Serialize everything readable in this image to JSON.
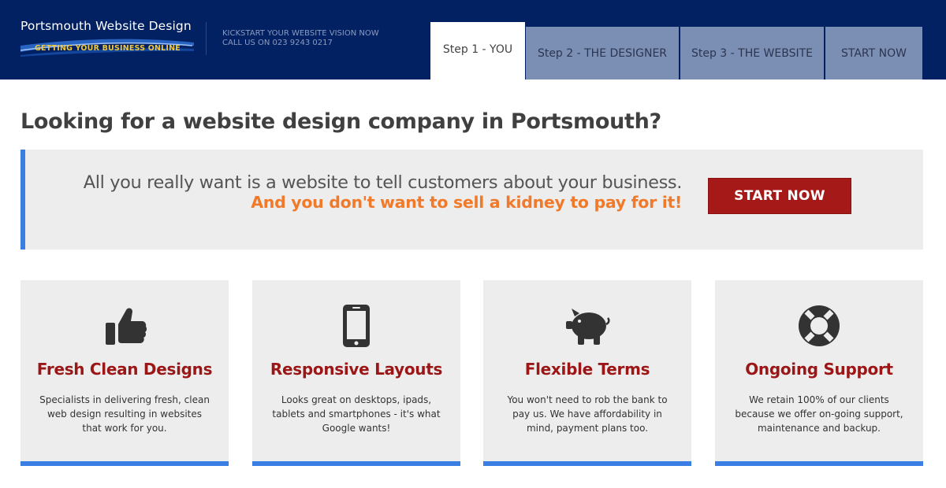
{
  "header": {
    "logo_title": "Portsmouth Website Design",
    "logo_tagline": "GETTING YOUR BUSINESS ONLINE",
    "tagline_line1": "KICKSTART YOUR WEBSITE VISION NOW",
    "tagline_line2": "CALL US ON 023 9243 0217"
  },
  "nav": {
    "tabs": [
      {
        "label": "Step 1 - YOU",
        "active": true
      },
      {
        "label": "Step 2 - THE DESIGNER",
        "active": false
      },
      {
        "label": "Step 3 - THE WEBSITE",
        "active": false
      },
      {
        "label": "START NOW",
        "active": false
      }
    ]
  },
  "main": {
    "headline": "Looking for a website design company in Portsmouth?",
    "banner": {
      "line1": "All you really want is a website to tell customers about your business.",
      "line2": "And you don't want to sell a kidney to pay for it!",
      "button_label": "START NOW"
    },
    "features": [
      {
        "icon": "thumbs-up-icon",
        "title": "Fresh Clean Designs",
        "text": "Specialists in delivering fresh, clean web design resulting in websites that work for you."
      },
      {
        "icon": "tablet-icon",
        "title": "Responsive Layouts",
        "text": "Looks great on desktops, ipads, tablets and smartphones - it's what Google wants!"
      },
      {
        "icon": "piggy-bank-icon",
        "title": "Flexible Terms",
        "text": "You won't need to rob the bank to pay us. We have affordability in mind, payment plans too."
      },
      {
        "icon": "life-ring-icon",
        "title": "Ongoing Support",
        "text": "We retain 100% of our clients because we offer on-going support, maintenance and backup."
      }
    ]
  },
  "colors": {
    "header_bg": "#012163",
    "tab_inactive": "#7b8fb5",
    "accent_blue": "#3a7ee3",
    "accent_orange": "#f07a2a",
    "button_red": "#a51919",
    "title_red": "#9b1616",
    "logo_gold": "#f0c63c"
  }
}
